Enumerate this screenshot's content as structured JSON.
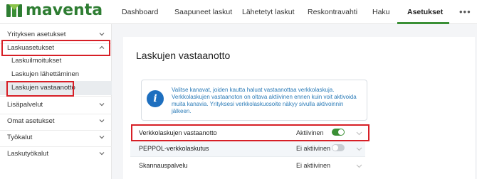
{
  "brand": {
    "name": "maventa",
    "color": "#2e7d32"
  },
  "nav": {
    "items": [
      {
        "label": "Dashboard",
        "active": false
      },
      {
        "label": "Saapuneet laskut",
        "active": false
      },
      {
        "label": "Lähetetyt laskut",
        "active": false
      },
      {
        "label": "Reskontravahti",
        "active": false
      },
      {
        "label": "Haku",
        "active": false
      },
      {
        "label": "Asetukset",
        "active": true
      }
    ],
    "more_icon": "more-horizontal-icon",
    "accent": "#3a8f35"
  },
  "sidebar": {
    "groups": [
      {
        "label": "Yrityksen asetukset",
        "expanded": false
      },
      {
        "label": "Laskuasetukset",
        "expanded": true,
        "items": [
          {
            "label": "Laskuilmoitukset",
            "selected": false
          },
          {
            "label": "Laskujen lähettäminen",
            "selected": false
          },
          {
            "label": "Laskujen vastaanotto",
            "selected": true
          }
        ]
      },
      {
        "label": "Lisäpalvelut",
        "expanded": false
      },
      {
        "label": "Omat asetukset",
        "expanded": false
      },
      {
        "label": "Työkalut",
        "expanded": false
      },
      {
        "label": "Laskutyökalut",
        "expanded": false
      }
    ]
  },
  "main": {
    "title": "Laskujen vastaanotto",
    "info": {
      "icon": "info-icon",
      "text": "Valitse kanavat, joiden kautta haluat vastaanottaa verkkolaskuja. Verkkolaskujen vastaanoton on oltava aktiivinen ennen kuin voit aktivoida muita kanavia. Yrityksesi verkkolaskuosoite näkyy sivulla aktivoinnin jälkeen."
    },
    "channels": [
      {
        "name": "Verkkolaskujen vastaanotto",
        "status": "Aktiivinen",
        "enabled": true
      },
      {
        "name": "PEPPOL-verkkolaskutus",
        "status": "Ei aktiivinen",
        "enabled": false
      },
      {
        "name": "Skannauspalvelu",
        "status": "Ei aktiivinen",
        "enabled": null
      }
    ]
  },
  "colors": {
    "highlight": "#d71f26",
    "toggle_on": "#3a8f35",
    "toggle_off": "#c8cdd2",
    "info_text": "#2c7cb8",
    "info_icon_bg": "#1e6fbf"
  }
}
